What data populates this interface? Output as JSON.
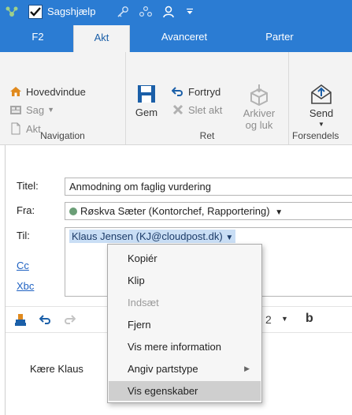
{
  "titlebar": {
    "title": "Sagshjælp",
    "checked": true,
    "bg_color": "#2b7cd3",
    "icons": [
      "app-icon",
      "checkbox-icon",
      "key-icon",
      "people-icon",
      "person-icon",
      "customize-dropdown-icon"
    ]
  },
  "tabs": [
    {
      "label": "F2",
      "active": false
    },
    {
      "label": "Akt",
      "active": true
    },
    {
      "label": "Avanceret",
      "active": false
    },
    {
      "label": "Parter",
      "active": false
    }
  ],
  "ribbon": {
    "navigation": {
      "label": "Navigation",
      "items": {
        "hovedvindue": "Hovedvindue",
        "sag": "Sag",
        "akt": "Akt"
      }
    },
    "ret": {
      "label": "Ret",
      "gem": "Gem",
      "fortryd": "Fortryd",
      "slet_akt": "Slet akt",
      "arkiver_line1": "Arkiver",
      "arkiver_line2": "og luk"
    },
    "forsendelse": {
      "label": "Forsendels",
      "send": "Send"
    }
  },
  "header": {
    "titel_label": "Titel:",
    "titel_value": "Anmodning om faglig vurdering",
    "fra_label": "Fra:",
    "fra_value": "Røskva Sæter (Kontorchef, Rapportering)",
    "til_label": "Til:",
    "til_value": "Klaus Jensen (KJ@cloudpost.dk)",
    "cc_label": "Cc",
    "xbc_label": "Xbc"
  },
  "editor": {
    "font_size_partial": "2",
    "bold": "b",
    "body_text_partial": "Kære Klaus"
  },
  "context_menu": {
    "items": [
      {
        "label": "Kopiér",
        "disabled": false
      },
      {
        "label": "Klip",
        "disabled": false
      },
      {
        "label": "Indsæt",
        "disabled": true
      },
      {
        "label": "Fjern",
        "disabled": false
      },
      {
        "label": "Vis mere information",
        "disabled": false
      },
      {
        "label": "Angiv partstype",
        "disabled": false,
        "submenu": true
      },
      {
        "label": "Vis egenskaber",
        "disabled": false,
        "hover": true
      }
    ]
  },
  "colors": {
    "accent": "#2b7cd3",
    "selection": "#c9def5",
    "link": "#1f62c2",
    "status_green": "#6a9e76"
  }
}
